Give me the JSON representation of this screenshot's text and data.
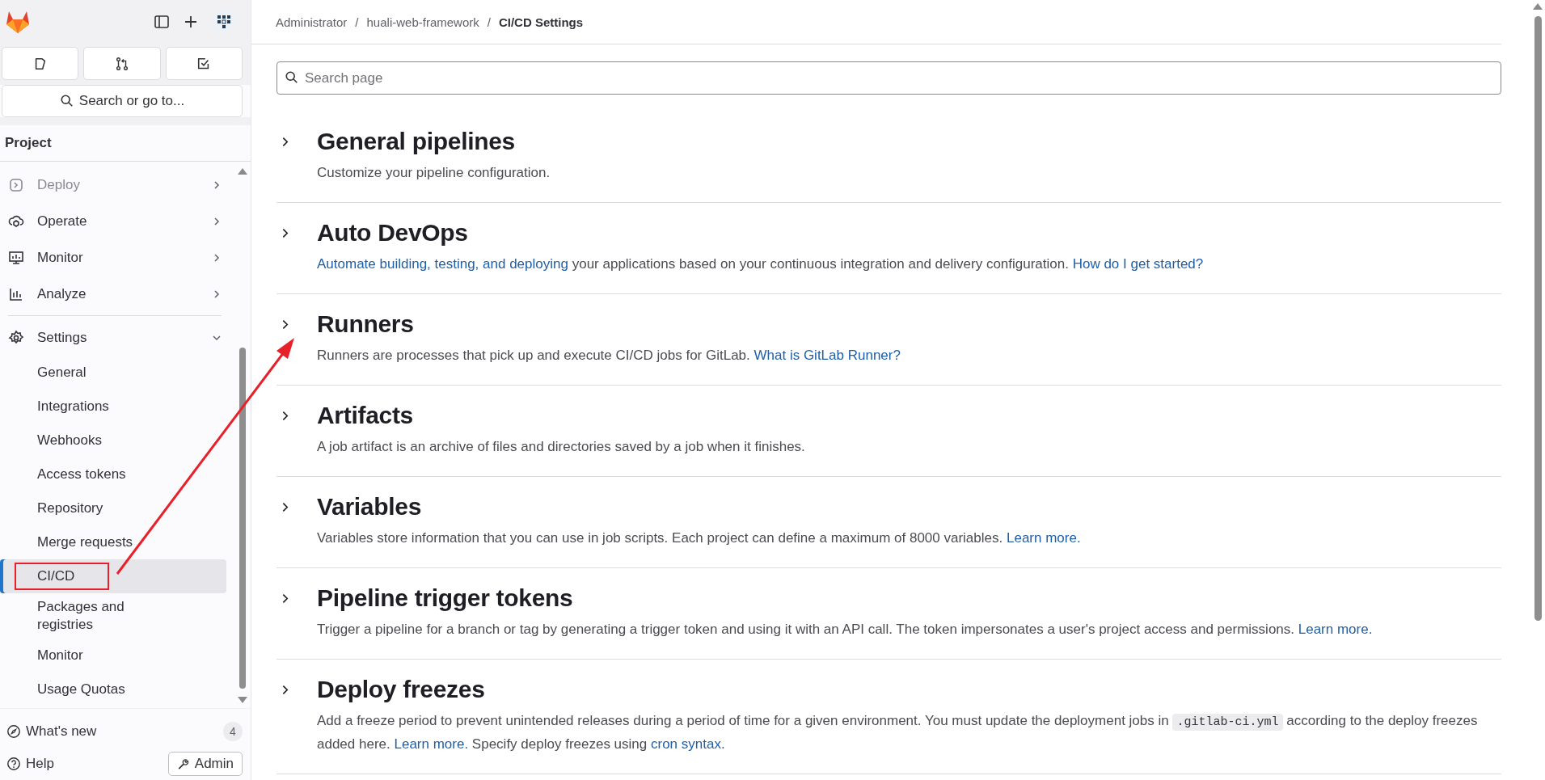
{
  "sidebar": {
    "search": {
      "placeholder": "Search or go to..."
    },
    "section_title": "Project",
    "nav_items": [
      {
        "label": "Deploy",
        "faded": true,
        "expanded": false
      },
      {
        "label": "Operate",
        "faded": false,
        "expanded": false
      },
      {
        "label": "Monitor",
        "faded": false,
        "expanded": false
      },
      {
        "label": "Analyze",
        "faded": false,
        "expanded": false
      },
      {
        "label": "Settings",
        "faded": false,
        "expanded": true,
        "children": [
          {
            "label": "General",
            "selected": false
          },
          {
            "label": "Integrations",
            "selected": false
          },
          {
            "label": "Webhooks",
            "selected": false
          },
          {
            "label": "Access tokens",
            "selected": false
          },
          {
            "label": "Repository",
            "selected": false
          },
          {
            "label": "Merge requests",
            "selected": false
          },
          {
            "label": "CI/CD",
            "selected": true
          },
          {
            "label": "Packages and registries",
            "selected": false
          },
          {
            "label": "Monitor",
            "selected": false
          },
          {
            "label": "Usage Quotas",
            "selected": false
          }
        ]
      }
    ],
    "whats_new": {
      "label": "What's new",
      "count": "4"
    },
    "help": {
      "label": "Help"
    },
    "admin_button": {
      "label": "Admin"
    }
  },
  "breadcrumb": [
    {
      "label": "Administrator"
    },
    {
      "separator": "/",
      "label": "huali-web-framework"
    },
    {
      "separator": "/",
      "label": "CI/CD Settings"
    }
  ],
  "search_page": {
    "placeholder": "Search page"
  },
  "sections": [
    {
      "title": "General pipelines",
      "expanded": false,
      "description": [
        {
          "kind": "text",
          "text": "Customize your pipeline configuration."
        }
      ]
    },
    {
      "title": "Auto DevOps",
      "expanded": false,
      "description": [
        {
          "kind": "link",
          "text": "Automate building, testing, and deploying"
        },
        {
          "kind": "text",
          "text": " your applications based on your continuous integration and delivery configuration. "
        },
        {
          "kind": "link",
          "text": "How do I get started?"
        }
      ]
    },
    {
      "title": "Runners",
      "expanded": false,
      "description": [
        {
          "kind": "text",
          "text": "Runners are processes that pick up and execute CI/CD jobs for GitLab. "
        },
        {
          "kind": "link",
          "text": "What is GitLab Runner?"
        }
      ]
    },
    {
      "title": "Artifacts",
      "expanded": false,
      "description": [
        {
          "kind": "text",
          "text": "A job artifact is an archive of files and directories saved by a job when it finishes."
        }
      ]
    },
    {
      "title": "Variables",
      "expanded": false,
      "description": [
        {
          "kind": "text",
          "text": "Variables store information that you can use in job scripts. Each project can define a maximum of 8000 variables. "
        },
        {
          "kind": "link",
          "text": "Learn more."
        }
      ]
    },
    {
      "title": "Pipeline trigger tokens",
      "expanded": false,
      "description": [
        {
          "kind": "text",
          "text": "Trigger a pipeline for a branch or tag by generating a trigger token and using it with an API call. The token impersonates a user's project access and permissions. "
        },
        {
          "kind": "link",
          "text": "Learn more."
        }
      ]
    },
    {
      "title": "Deploy freezes",
      "expanded": false,
      "description": [
        {
          "kind": "text",
          "text": "Add a freeze period to prevent unintended releases during a period of time for a given environment. You must update the deployment jobs in "
        },
        {
          "kind": "code",
          "text": ".gitlab-ci.yml"
        },
        {
          "kind": "text",
          "text": " according to the deploy freezes added here. "
        },
        {
          "kind": "link",
          "text": "Learn more."
        },
        {
          "kind": "text",
          "text": " Specify deploy freezes using "
        },
        {
          "kind": "link",
          "text": "cron syntax"
        },
        {
          "kind": "text",
          "text": "."
        }
      ]
    }
  ]
}
